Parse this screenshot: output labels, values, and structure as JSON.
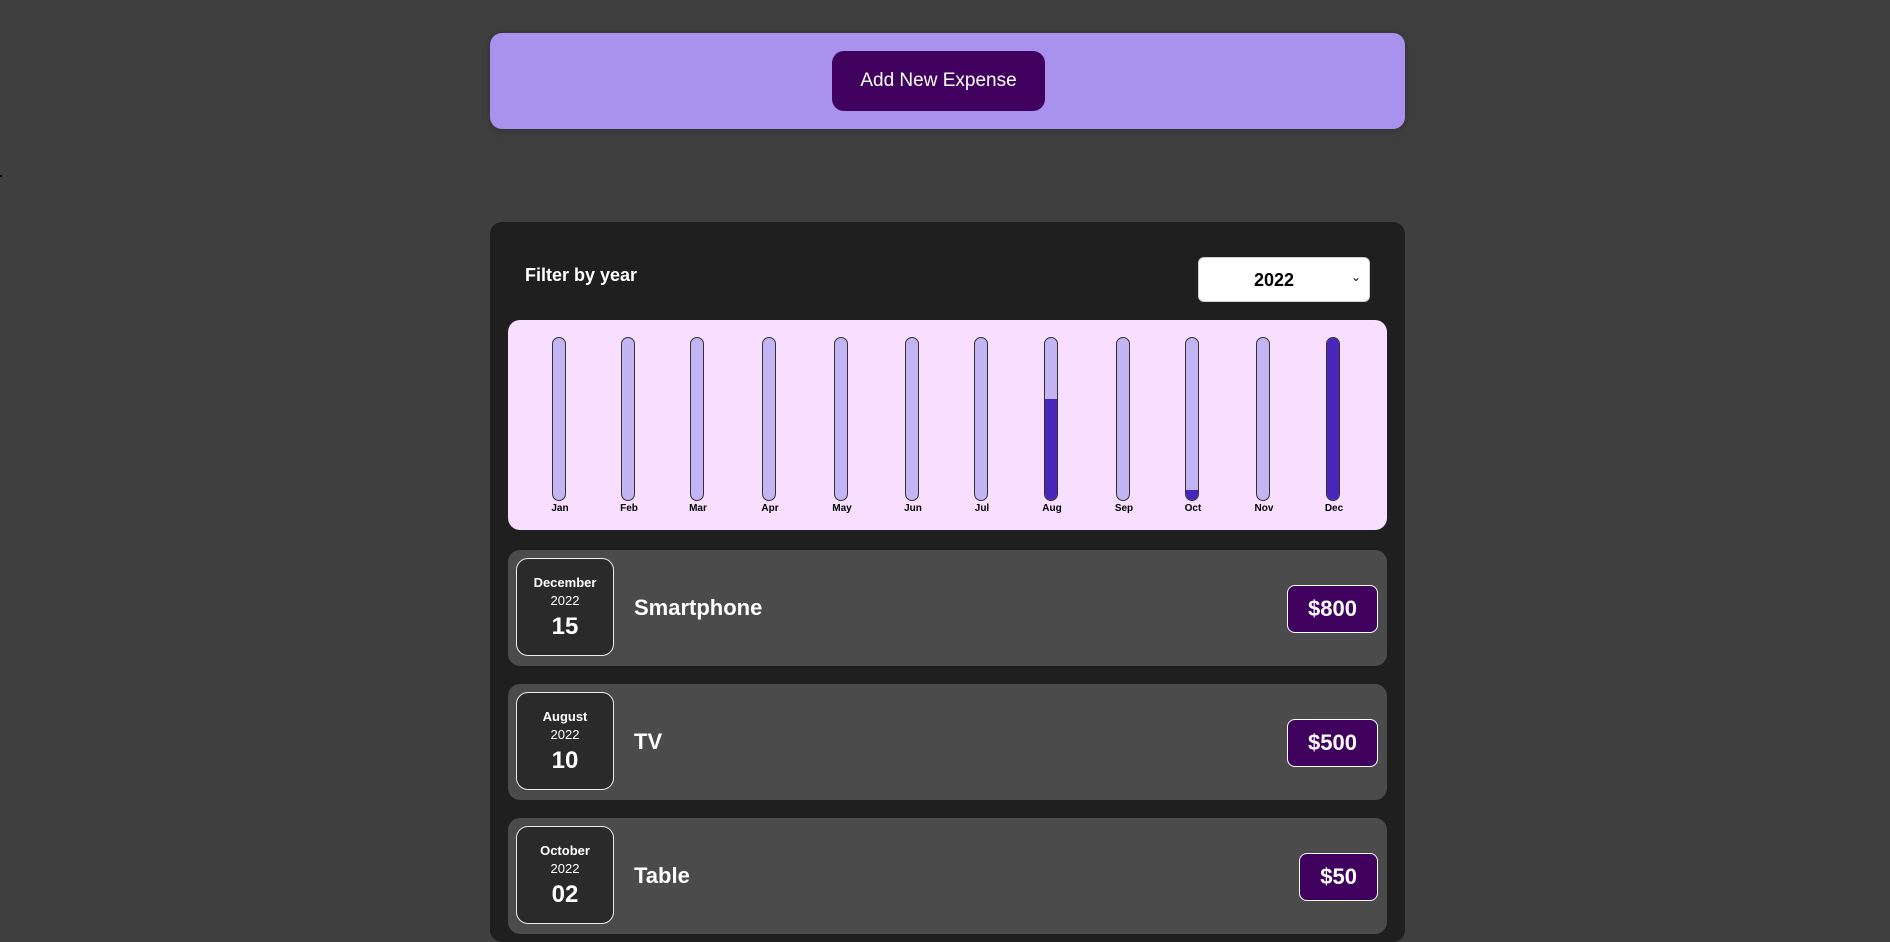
{
  "new_expense": {
    "add_button_label": "Add New Expense"
  },
  "filter": {
    "label": "Filter by year",
    "selected_year": "2022"
  },
  "chart_data": {
    "type": "bar",
    "categories": [
      "Jan",
      "Feb",
      "Mar",
      "Apr",
      "May",
      "Jun",
      "Jul",
      "Aug",
      "Sep",
      "Oct",
      "Nov",
      "Dec"
    ],
    "values": [
      0,
      0,
      0,
      0,
      0,
      0,
      0,
      500,
      0,
      50,
      0,
      800
    ],
    "ylim": [
      0,
      800
    ],
    "colors": {
      "track": "#c3b4f3",
      "fill": "#4826b9"
    }
  },
  "expenses": [
    {
      "month": "December",
      "year": "2022",
      "day": "15",
      "title": "Smartphone",
      "amount": "$800"
    },
    {
      "month": "August",
      "year": "2022",
      "day": "10",
      "title": "TV",
      "amount": "$500"
    },
    {
      "month": "October",
      "year": "2022",
      "day": "02",
      "title": "Table",
      "amount": "$50"
    }
  ],
  "colors": {
    "page_bg": "#3f3f3f",
    "header_bg": "#a892ee",
    "button_bg": "#40005d",
    "panel_bg": "#1f1f1f",
    "chart_bg": "#f8dfff",
    "item_bg": "#4b4b4b"
  }
}
